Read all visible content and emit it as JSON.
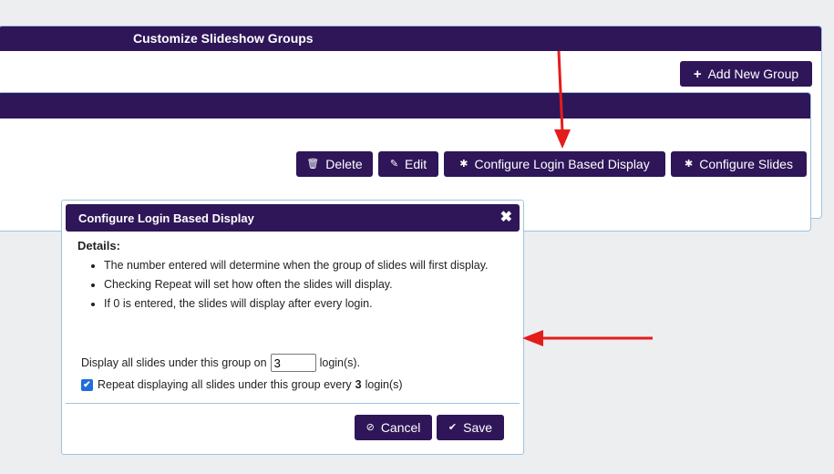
{
  "panel": {
    "title": "Customize Slideshow Groups",
    "add_group_label": "Add New Group"
  },
  "group_actions": {
    "delete_label": "Delete",
    "edit_label": "Edit",
    "configure_login_label": "Configure Login Based Display",
    "configure_slides_label": "Configure Slides"
  },
  "modal": {
    "title": "Configure Login Based Display",
    "close_glyph": "✖",
    "details_label": "Details:",
    "details": [
      "The number entered will determine when the group of slides will first display.",
      "Checking Repeat will set how often the slides will display.",
      "If 0 is entered, the slides will display after every login."
    ],
    "display_prefix": "Display all slides under this group on",
    "display_value": "3",
    "display_suffix": "login(s).",
    "repeat_checked": true,
    "repeat_prefix": "Repeat displaying all slides under this group every",
    "repeat_value": "3",
    "repeat_suffix": "login(s)",
    "cancel_label": "Cancel",
    "save_label": "Save"
  },
  "icons": {
    "plus": "+",
    "trash": "🗑",
    "pencil": "✎",
    "gear": "✱",
    "cancel": "⊘",
    "check": "✔"
  },
  "colors": {
    "accent": "#2e1658",
    "border": "#9fc3e0",
    "annotation_arrow": "#e51c1c"
  }
}
